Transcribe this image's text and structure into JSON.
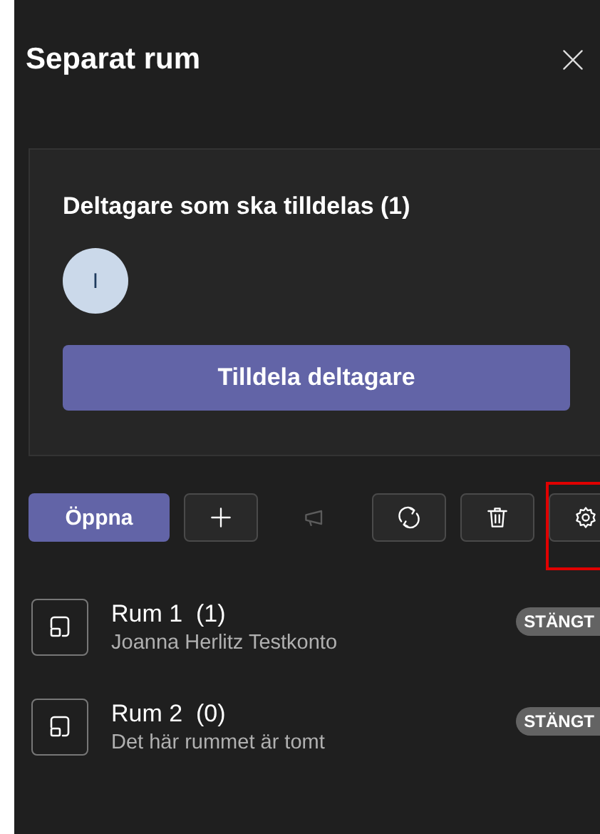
{
  "panel": {
    "title": "Separat rum"
  },
  "unassigned": {
    "heading": "Deltagare som ska tilldelas (1)",
    "avatars": [
      {
        "initial": "I"
      }
    ],
    "button": "Tilldela deltagare"
  },
  "toolbar": [
    {
      "kind": "text",
      "label": "Öppna",
      "disabled": false,
      "highlighted": false
    },
    {
      "kind": "add",
      "disabled": false,
      "highlighted": false
    },
    {
      "kind": "announce",
      "disabled": true,
      "highlighted": false
    },
    {
      "kind": "recreate",
      "disabled": false,
      "highlighted": false
    },
    {
      "kind": "delete",
      "disabled": false,
      "highlighted": false
    },
    {
      "kind": "settings",
      "disabled": false,
      "highlighted": true
    }
  ],
  "rooms": [
    {
      "name": "Rum 1  (1)",
      "detail": "Joanna Herlitz Testkonto",
      "status": "STÄNGT"
    },
    {
      "name": "Rum 2  (0)",
      "detail": "Det här rummet är tomt",
      "status": "STÄNGT"
    }
  ]
}
